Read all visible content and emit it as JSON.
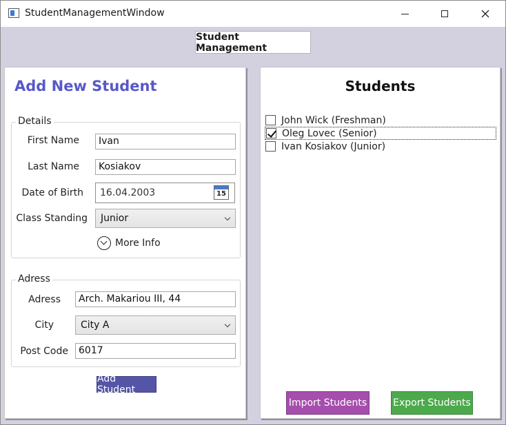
{
  "window": {
    "title": "StudentManagementWindow",
    "icon": "app-window-icon",
    "controls": [
      "minimize-icon",
      "maximize-icon",
      "close-icon"
    ]
  },
  "header": {
    "label": "Student Management"
  },
  "form": {
    "heading": "Add New Student",
    "details": {
      "legend": "Details",
      "first_name_label": "First Name",
      "first_name_value": "Ivan",
      "last_name_label": "Last Name",
      "last_name_value": "Kosiakov",
      "dob_label": "Date of Birth",
      "dob_value": "16.04.2003",
      "calendar_day": "15",
      "class_standing_label": "Class Standing",
      "class_standing_value": "Junior",
      "more_info_label": "More Info"
    },
    "address": {
      "legend": "Adress",
      "address_label": "Adress",
      "address_value": "Arch. Makariou III, 44",
      "city_label": "City",
      "city_value": "City A",
      "post_code_label": "Post Code",
      "post_code_value": "6017"
    },
    "add_button": "Add Student"
  },
  "students": {
    "title": "Students",
    "items": [
      {
        "label": "John Wick (Freshman)",
        "checked": false
      },
      {
        "label": "Oleg Lovec (Senior)",
        "checked": true
      },
      {
        "label": "Ivan Kosiakov (Junior)",
        "checked": false
      }
    ],
    "import_button": "Import Students",
    "export_button": "Export Students"
  },
  "colors": {
    "heading": "#5858c9",
    "window_bg": "#d3d1e0",
    "add_button": "#5555a8",
    "import_button": "#a64ead",
    "export_button": "#4caa4c"
  }
}
